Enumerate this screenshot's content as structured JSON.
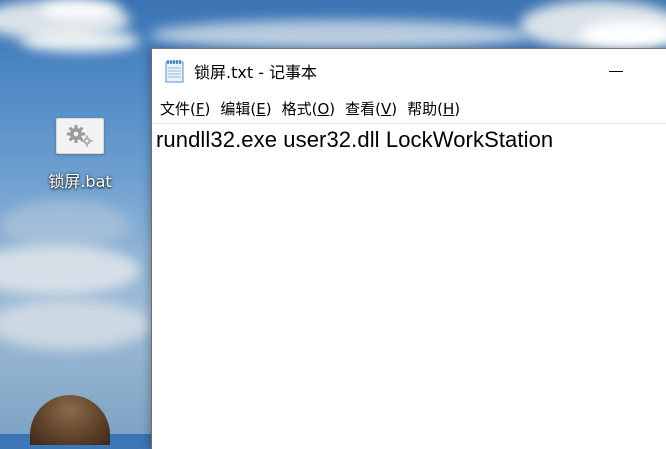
{
  "desktop": {
    "icons": [
      {
        "label": "锁屏.bat",
        "icon": "batch-file-gears-icon"
      }
    ]
  },
  "window": {
    "title": "锁屏.txt - 记事本",
    "app_icon": "notepad-icon",
    "controls": {
      "minimize_icon": "minimize-icon"
    },
    "menu": [
      {
        "label": "文件",
        "accel": "F"
      },
      {
        "label": "编辑",
        "accel": "E"
      },
      {
        "label": "格式",
        "accel": "O"
      },
      {
        "label": "查看",
        "accel": "V"
      },
      {
        "label": "帮助",
        "accel": "H"
      }
    ],
    "content": "rundll32.exe user32.dll LockWorkStation"
  }
}
